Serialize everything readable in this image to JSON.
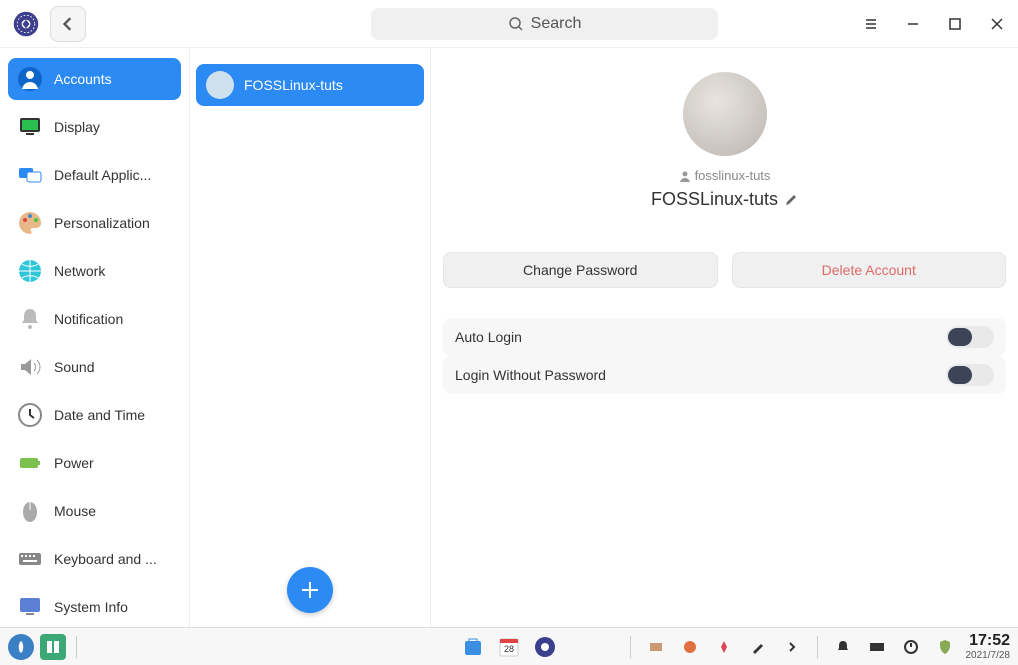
{
  "titlebar": {
    "search_placeholder": "Search"
  },
  "sidebar": {
    "items": [
      {
        "label": "Accounts"
      },
      {
        "label": "Display"
      },
      {
        "label": "Default Applic..."
      },
      {
        "label": "Personalization"
      },
      {
        "label": "Network"
      },
      {
        "label": "Notification"
      },
      {
        "label": "Sound"
      },
      {
        "label": "Date and Time"
      },
      {
        "label": "Power"
      },
      {
        "label": "Mouse"
      },
      {
        "label": "Keyboard and ..."
      },
      {
        "label": "System Info"
      }
    ]
  },
  "users": {
    "list": [
      {
        "name": "FOSSLinux-tuts"
      }
    ]
  },
  "detail": {
    "username": "fosslinux-tuts",
    "display_name": "FOSSLinux-tuts",
    "change_password": "Change Password",
    "delete_account": "Delete Account",
    "auto_login": "Auto Login",
    "login_without_password": "Login Without Password"
  },
  "taskbar": {
    "time": "17:52",
    "date": "2021/7/28",
    "calendar_day": "28"
  }
}
